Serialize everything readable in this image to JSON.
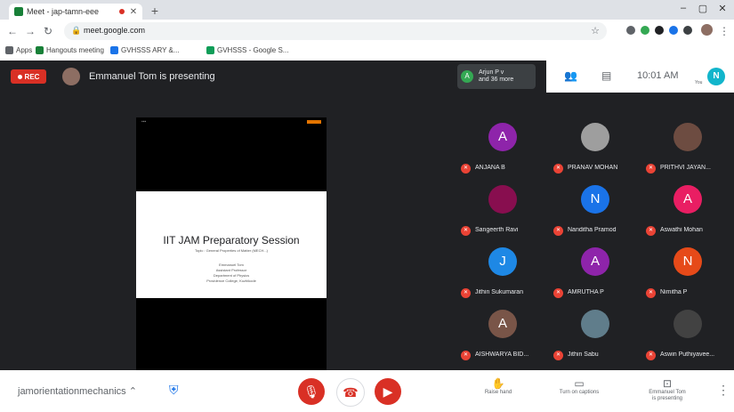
{
  "browser": {
    "tab_title": "Meet - jap-tamn-eee",
    "url": "meet.google.com",
    "bookmarks": [
      "Apps",
      "Hangouts meeting",
      "GVHSSS ARY &...",
      "GVHSSS - Google S..."
    ]
  },
  "meet_top": {
    "rec_label": "REC",
    "presenting_text": "Emmanuel Tom is presenting",
    "people_line1": "Arjun P v",
    "people_line2": "and 36 more",
    "people_avatar_letter": "A",
    "clock": "10:01 AM",
    "me_letter": "N",
    "me_sub": "You"
  },
  "slide": {
    "title": "IIT JAM Preparatory Session",
    "subtitle": "Topic : General Properties of Matter (MECH...)",
    "lines": [
      "Emmanuel Tom",
      "Assistant Professor",
      "Department of Physics",
      "Providence College, Kozhikode"
    ]
  },
  "participants": [
    {
      "letter": "A",
      "name": "ANJANA B",
      "color": "#8e24aa"
    },
    {
      "letter": "",
      "name": "PRANAV MOHAN",
      "color": "#9e9e9e"
    },
    {
      "letter": "",
      "name": "PRITHVI JAYAN...",
      "color": "#6d4c41"
    },
    {
      "letter": "",
      "name": "Sangeerth Ravi",
      "color": "#880e4f"
    },
    {
      "letter": "N",
      "name": "Nanditha Pramod",
      "color": "#1a73e8"
    },
    {
      "letter": "A",
      "name": "Aswathi Mohan",
      "color": "#e91e63"
    },
    {
      "letter": "J",
      "name": "Jithin Sukumaran",
      "color": "#1e88e5"
    },
    {
      "letter": "A",
      "name": "AMRUTHA P",
      "color": "#8e24aa"
    },
    {
      "letter": "N",
      "name": "Nimitha P",
      "color": "#e64a19"
    },
    {
      "letter": "A",
      "name": "AISHWARYA BID...",
      "color": "#795548"
    },
    {
      "letter": "",
      "name": "Jithin Sabu",
      "color": "#607d8b"
    },
    {
      "letter": "",
      "name": "Aswin Puthiyavee...",
      "color": "#424242"
    }
  ],
  "bottom": {
    "meeting_code": "jamorientationmechanics",
    "raise_hand": "Raise hand",
    "captions": "Turn on captions",
    "present_line1": "Emmanuel Tom",
    "present_line2": "is presenting"
  }
}
